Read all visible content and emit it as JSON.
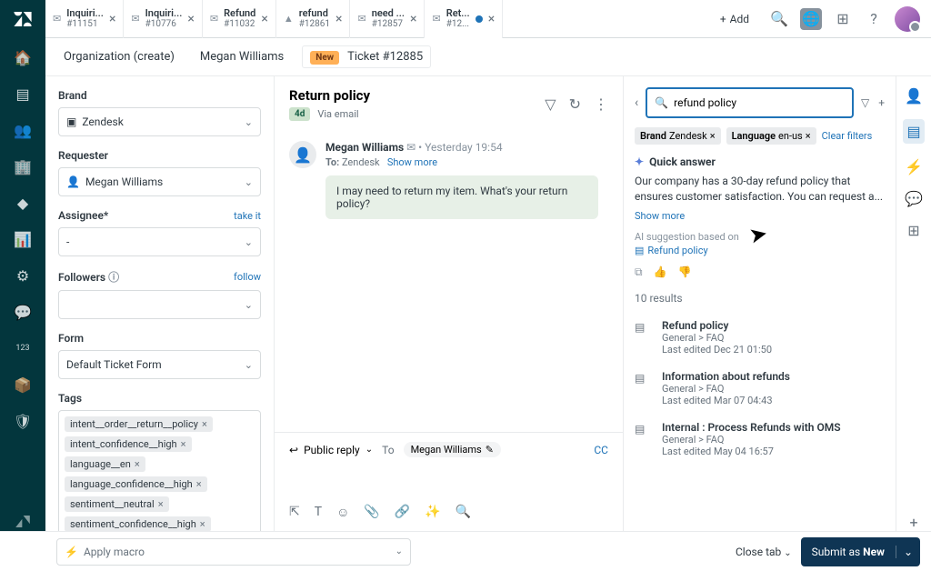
{
  "tabs": [
    {
      "title": "Inquiri...",
      "id": "#11151"
    },
    {
      "title": "Inquiri...",
      "id": "#10776"
    },
    {
      "title": "Refund",
      "id": "#11032"
    },
    {
      "title": "refund",
      "id": "#12861"
    },
    {
      "title": "need ...",
      "id": "#12857"
    },
    {
      "title": "Ret...",
      "id": "#12...",
      "unread": true
    }
  ],
  "add_tab": "Add",
  "breadcrumb": {
    "org": "Organization (create)",
    "user": "Megan Williams",
    "badge": "New",
    "ticket": "Ticket #12885"
  },
  "props": {
    "brand": {
      "label": "Brand",
      "value": "Zendesk"
    },
    "requester": {
      "label": "Requester",
      "value": "Megan Williams"
    },
    "assignee": {
      "label": "Assignee*",
      "value": "-",
      "take": "take it"
    },
    "followers": {
      "label": "Followers",
      "follow": "follow",
      "value": ""
    },
    "form": {
      "label": "Form",
      "value": "Default Ticket Form"
    },
    "tags": {
      "label": "Tags",
      "items": [
        "intent__order__return__policy",
        "intent_confidence__high",
        "language__en",
        "language_confidence__high",
        "sentiment__neutral",
        "sentiment_confidence__high"
      ]
    }
  },
  "convo": {
    "title": "Return policy",
    "age": "4d",
    "channel": "Via email",
    "sender": "Megan Williams",
    "time": "Yesterday 19:54",
    "to_label": "To:",
    "to": "Zendesk",
    "show_more": "Show more",
    "body": "I may need to return my item. What's your return policy?"
  },
  "composer": {
    "reply": "Public reply",
    "to_label": "To",
    "to": "Megan Williams",
    "cc": "CC"
  },
  "kb": {
    "search": "refund policy",
    "filters": [
      {
        "k": "Brand",
        "v": "Zendesk"
      },
      {
        "k": "Language",
        "v": "en-us"
      }
    ],
    "clear": "Clear filters",
    "quick": "Quick answer",
    "answer": "Our company has a 30-day refund policy that ensures customer satisfaction. You can request a...",
    "show_more": "Show more",
    "based_on": "AI suggestion based on",
    "source": "Refund policy",
    "results_count": "10 results",
    "results": [
      {
        "title": "Refund policy",
        "path": "General > FAQ",
        "edited": "Last edited Dec 21 01:50"
      },
      {
        "title": "Information about refunds",
        "path": "General > FAQ",
        "edited": "Last edited Mar 07 04:43"
      },
      {
        "title": "Internal : Process Refunds with OMS",
        "path": "General > FAQ",
        "edited": "Last edited May 04 16:57"
      }
    ]
  },
  "footer": {
    "macro": "Apply macro",
    "close": "Close tab",
    "submit_prefix": "Submit as ",
    "submit_status": "New"
  }
}
